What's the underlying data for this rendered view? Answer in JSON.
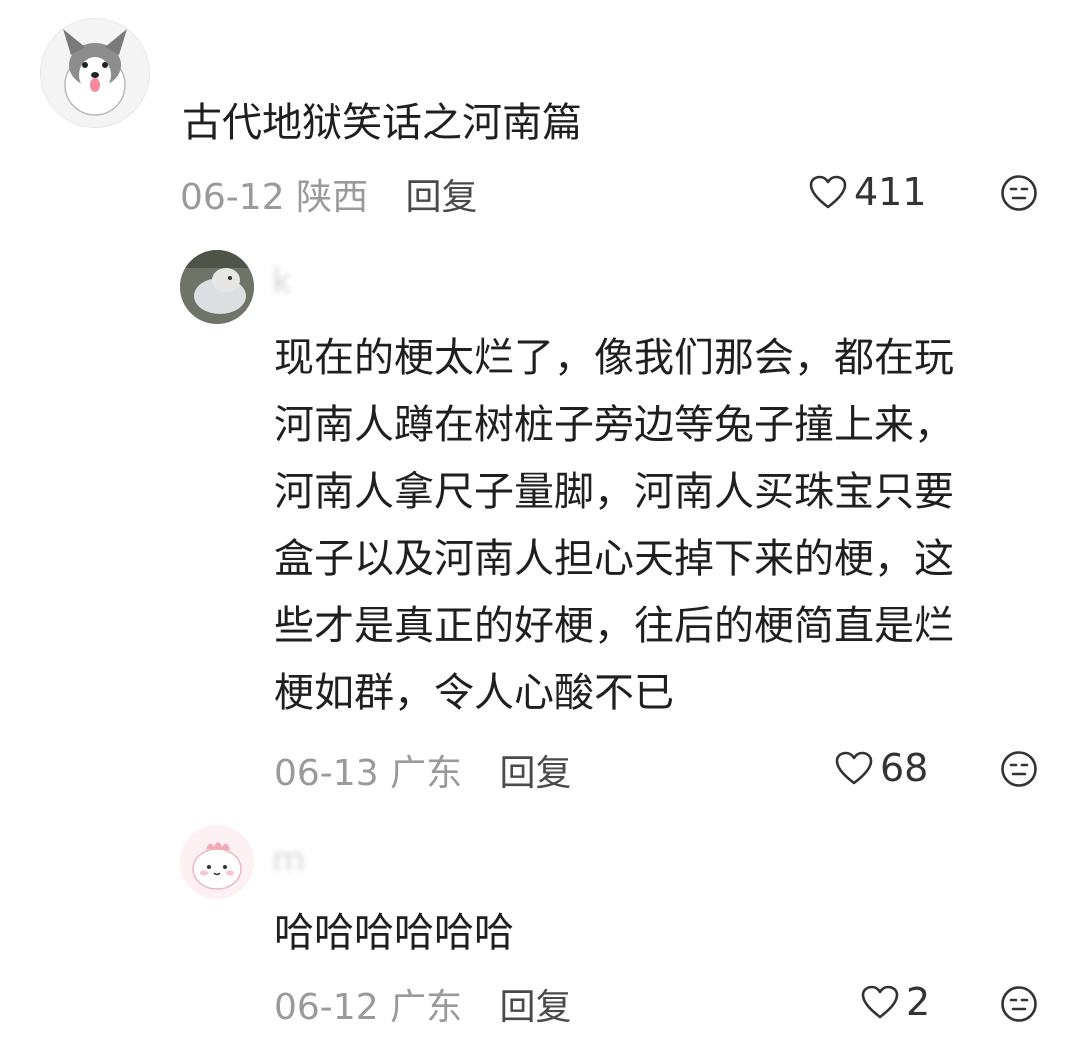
{
  "comment": {
    "text": "古代地狱笑话之河南篇",
    "date": "06-12",
    "location": "陕西",
    "reply_label": "回复",
    "likes": "411",
    "avatar": "husky-dog-avatar"
  },
  "replies": [
    {
      "username": "k",
      "lines": [
        "现在的梗太烂了，像我们那会，都在玩",
        "河南人蹲在树桩子旁边等兔子撞上来，",
        "河南人拿尺子量脚，河南人买珠宝只要",
        "盒子以及河南人担心天掉下来的梗，这",
        "些才是真正的好梗，往后的梗简直是烂",
        "梗如群，令人心酸不已"
      ],
      "date": "06-13",
      "location": "广东",
      "reply_label": "回复",
      "likes": "68",
      "avatar": "hamster-photo-avatar"
    },
    {
      "username": "m",
      "text": "哈哈哈哈哈哈",
      "date": "06-12",
      "location": "广东",
      "reply_label": "回复",
      "likes": "2",
      "avatar": "pink-cartoon-avatar"
    }
  ],
  "colors": {
    "text": "#1f1f1f",
    "meta": "#9a9a9a",
    "reply": "#4a4a4a"
  }
}
